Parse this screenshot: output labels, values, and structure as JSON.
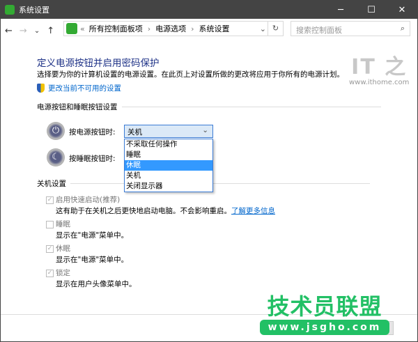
{
  "window": {
    "title": "系统设置",
    "minimize": "─",
    "maximize": "☐",
    "close": "✕"
  },
  "nav": {
    "back": "←",
    "forward": "→",
    "recent": "⌄",
    "up": "↑",
    "breadcrumb": [
      "所有控制面板项",
      "电源选项",
      "系统设置"
    ],
    "overflow": "«",
    "dropdown": "⌄",
    "refresh": "↻",
    "search_placeholder": "搜索控制面板",
    "search_icon": "⌕"
  },
  "page": {
    "title": "定义电源按钮并启用密码保护",
    "description": "选择要为你的计算机设置的电源设置。在此页上对设置所做的更改将应用于你所有的电源计划。",
    "admin_link": "更改当前不可用的设置",
    "section1": "电源按钮和睡眠按钮设置",
    "power_label": "按电源按钮时:",
    "sleep_label": "按睡眠按钮时:",
    "power_value": "关机",
    "options": [
      "不采取任何操作",
      "睡眠",
      "休眠",
      "关机",
      "关闭显示器"
    ],
    "highlighted_option": "休眠",
    "section2": "关机设置",
    "checkboxes": [
      {
        "label": "启用快速启动(推荐)",
        "desc": "这有助于在关机之后更快地启动电脑。不会影响重启。",
        "link": "了解更多信息",
        "checked": true
      },
      {
        "label": "睡眠",
        "desc": "显示在\"电源\"菜单中。",
        "checked": false
      },
      {
        "label": "休眠",
        "desc": "显示在\"电源\"菜单中。",
        "checked": true
      },
      {
        "label": "锁定",
        "desc": "显示在用户头像菜单中。",
        "checked": true
      }
    ]
  },
  "watermarks": {
    "ithome_logo": "IT之家",
    "ithome_url": "www.ithome.com",
    "jsgho_big": "技术员联盟",
    "jsgho_url": "www.jsgho.com"
  },
  "colors": {
    "title": "#1e3287",
    "link": "#0066cc",
    "highlight": "#3399ff",
    "watermark": "#22c065"
  }
}
